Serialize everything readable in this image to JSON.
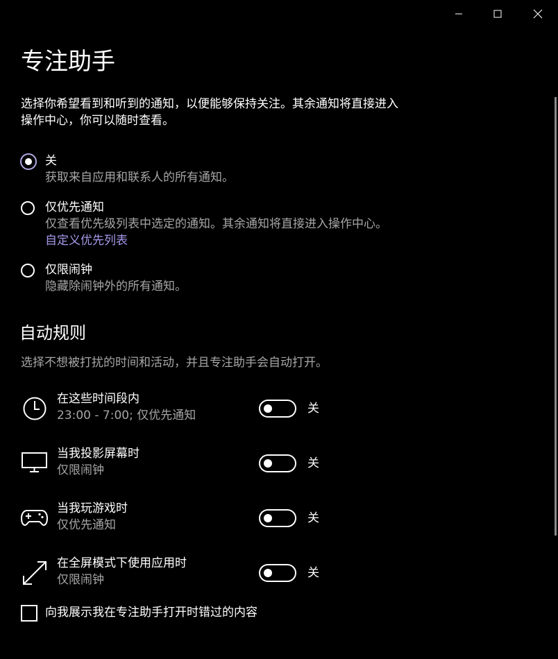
{
  "window": {
    "controls": [
      "minimize-icon",
      "maximize-icon",
      "close-icon"
    ]
  },
  "page": {
    "title": "专注助手",
    "intro_line1": "选择你希望看到和听到的通知，以便能够保持关注。其余通知将直接进入",
    "intro_line2": "操作中心，你可以随时查看。"
  },
  "modes": [
    {
      "label": "关",
      "description": "获取来自应用和联系人的所有通知。",
      "selected": true
    },
    {
      "label": "仅优先通知",
      "description": "仅查看优先级列表中选定的通知。其余通知将直接进入操作中心。",
      "link": "自定义优先列表",
      "selected": false
    },
    {
      "label": "仅限闹钟",
      "description": "隐藏除闹钟外的所有通知。",
      "selected": false
    }
  ],
  "auto_rules": {
    "title": "自动规则",
    "description": "选择不想被打扰的时间和活动，并且专注助手会自动打开。",
    "rules": [
      {
        "icon": "clock-icon",
        "title": "在这些时间段内",
        "subtitle": "23:00 - 7:00; 仅优先通知",
        "state_label": "关",
        "on": false
      },
      {
        "icon": "monitor-icon",
        "title": "当我投影屏幕时",
        "subtitle": "仅限闹钟",
        "state_label": "关",
        "on": false
      },
      {
        "icon": "gamepad-icon",
        "title": "当我玩游戏时",
        "subtitle": "仅优先通知",
        "state_label": "关",
        "on": false
      },
      {
        "icon": "fullscreen-arrow-icon",
        "title": "在全屏模式下使用应用时",
        "subtitle": "仅限闹钟",
        "state_label": "关",
        "on": false
      }
    ]
  },
  "summary_checkbox": {
    "label": "向我展示我在专注助手打开时错过的内容",
    "checked": false
  },
  "colors": {
    "background": "#000000",
    "text": "#ffffff",
    "secondary_text": "#a6a6a6",
    "accent": "#a599e9"
  }
}
